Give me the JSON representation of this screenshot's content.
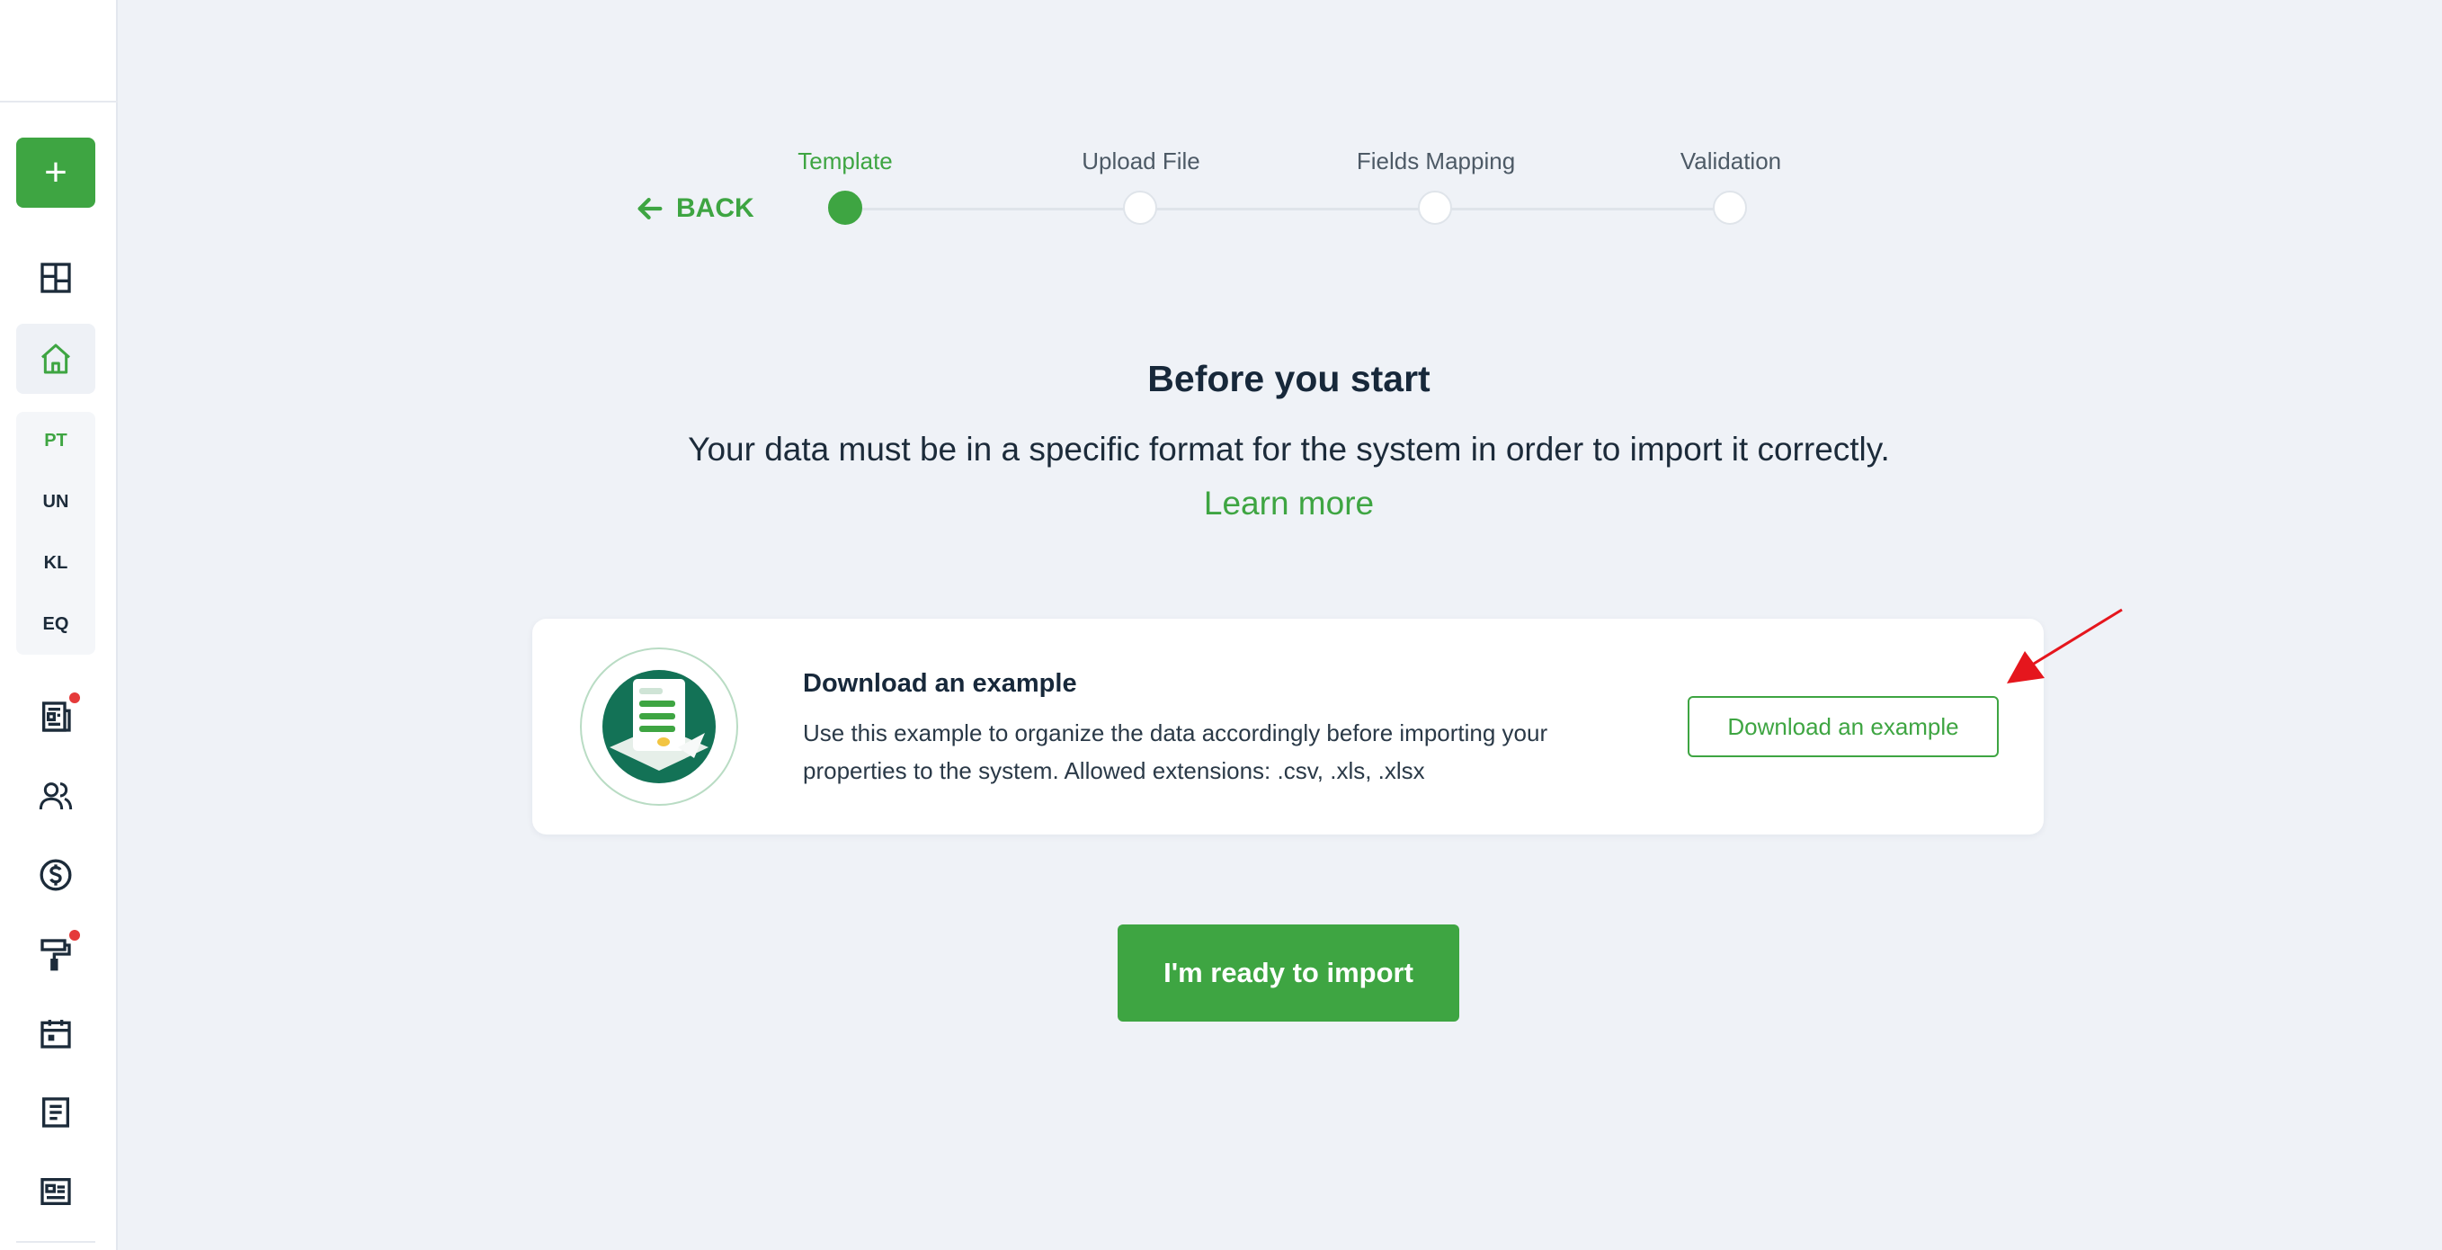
{
  "sidebar": {
    "add_label": "+",
    "abbr_items": [
      "PT",
      "UN",
      "KL",
      "EQ"
    ]
  },
  "stepper": {
    "back_label": "BACK",
    "steps": [
      "Template",
      "Upload File",
      "Fields Mapping",
      "Validation"
    ],
    "active_step": "Template"
  },
  "main": {
    "title": "Before you start",
    "subtitle": "Your data must be in a specific format for the system in order to import it correctly.",
    "learn_more": "Learn more"
  },
  "card": {
    "title": "Download an example",
    "description": "Use this example to organize the data accordingly before importing your properties to the system. Allowed extensions: .csv, .xls, .xlsx",
    "button_label": "Download an example"
  },
  "primary_button": "I'm ready to import",
  "colors": {
    "accent": "#3ea542",
    "background": "#eff2f7",
    "text": "#1c2b3a",
    "notification": "#e53a3a",
    "annotation_arrow": "#e5161d"
  }
}
